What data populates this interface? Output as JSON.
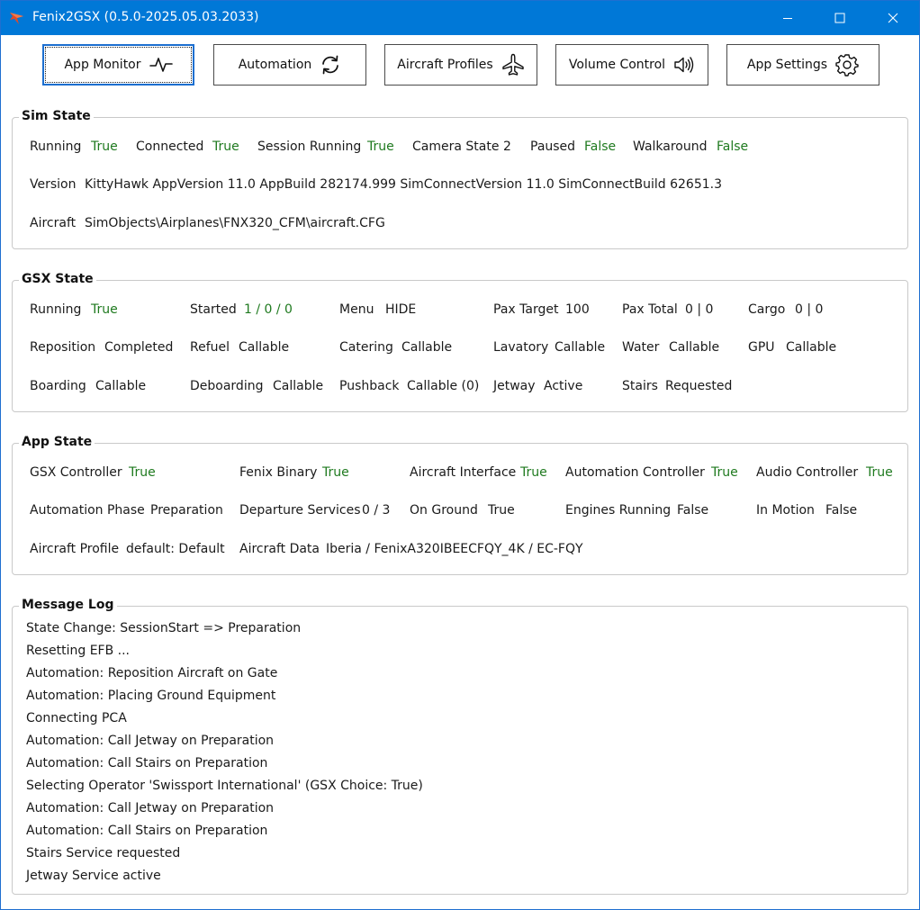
{
  "window": {
    "title": "Fenix2GSX (0.5.0-2025.05.03.2033)"
  },
  "nav": [
    {
      "label": "App Monitor",
      "icon": "activity-icon",
      "active": true
    },
    {
      "label": "Automation",
      "icon": "refresh-icon",
      "active": false
    },
    {
      "label": "Aircraft Profiles",
      "icon": "airplane-icon",
      "active": false
    },
    {
      "label": "Volume Control",
      "icon": "speaker-icon",
      "active": false
    },
    {
      "label": "App Settings",
      "icon": "gear-icon",
      "active": false
    }
  ],
  "colors": {
    "accent": "#0078d7",
    "ok_value": "#1f7a1f"
  },
  "sim_state": {
    "title": "Sim State",
    "running": {
      "label": "Running",
      "value": "True"
    },
    "connected": {
      "label": "Connected",
      "value": "True"
    },
    "session_running": {
      "label": "Session Running",
      "value": "True"
    },
    "camera_state": {
      "label": "Camera State",
      "value": "2"
    },
    "paused": {
      "label": "Paused",
      "value": "False"
    },
    "walkaround": {
      "label": "Walkaround",
      "value": "False"
    },
    "version": {
      "label": "Version",
      "value": "KittyHawk AppVersion 11.0 AppBuild 282174.999 SimConnectVersion 11.0 SimConnectBuild 62651.3"
    },
    "aircraft": {
      "label": "Aircraft",
      "value": "SimObjects\\Airplanes\\FNX320_CFM\\aircraft.CFG"
    }
  },
  "gsx_state": {
    "title": "GSX State",
    "running": {
      "label": "Running",
      "value": "True"
    },
    "started": {
      "label": "Started",
      "value": "1 / 0 / 0"
    },
    "menu": {
      "label": "Menu",
      "value": "HIDE"
    },
    "pax_target": {
      "label": "Pax Target",
      "value": "100"
    },
    "pax_total": {
      "label": "Pax Total",
      "value": "0 | 0"
    },
    "cargo": {
      "label": "Cargo",
      "value": "0 | 0"
    },
    "reposition": {
      "label": "Reposition",
      "value": "Completed"
    },
    "refuel": {
      "label": "Refuel",
      "value": "Callable"
    },
    "catering": {
      "label": "Catering",
      "value": "Callable"
    },
    "lavatory": {
      "label": "Lavatory",
      "value": "Callable"
    },
    "water": {
      "label": "Water",
      "value": "Callable"
    },
    "gpu": {
      "label": "GPU",
      "value": "Callable"
    },
    "boarding": {
      "label": "Boarding",
      "value": "Callable"
    },
    "deboarding": {
      "label": "Deboarding",
      "value": "Callable"
    },
    "pushback": {
      "label": "Pushback",
      "value": "Callable (0)"
    },
    "jetway": {
      "label": "Jetway",
      "value": "Active"
    },
    "stairs": {
      "label": "Stairs",
      "value": "Requested"
    }
  },
  "app_state": {
    "title": "App State",
    "gsx_controller": {
      "label": "GSX Controller",
      "value": "True"
    },
    "fenix_binary": {
      "label": "Fenix Binary",
      "value": "True"
    },
    "aircraft_interface": {
      "label": "Aircraft Interface",
      "value": "True"
    },
    "automation_controller": {
      "label": "Automation Controller",
      "value": "True"
    },
    "audio_controller": {
      "label": "Audio Controller",
      "value": "True"
    },
    "automation_phase": {
      "label": "Automation Phase",
      "value": "Preparation"
    },
    "departure_services": {
      "label": "Departure Services",
      "value": "0 / 3"
    },
    "on_ground": {
      "label": "On Ground",
      "value": "True"
    },
    "engines_running": {
      "label": "Engines Running",
      "value": "False"
    },
    "in_motion": {
      "label": "In Motion",
      "value": "False"
    },
    "aircraft_profile": {
      "label": "Aircraft Profile",
      "value": "default: Default"
    },
    "aircraft_data": {
      "label": "Aircraft Data",
      "value": "Iberia / FenixA320IBEECFQY_4K / EC-FQY"
    }
  },
  "message_log": {
    "title": "Message Log",
    "lines": [
      "State Change: SessionStart => Preparation",
      "Resetting EFB ...",
      "Automation: Reposition Aircraft on Gate",
      "Automation: Placing Ground Equipment",
      "Connecting PCA",
      "Automation: Call Jetway on Preparation",
      "Automation: Call Stairs on Preparation",
      "Selecting Operator 'Swissport International' (GSX Choice: True)",
      "Automation: Call Jetway on Preparation",
      "Automation: Call Stairs on Preparation",
      "Stairs Service requested",
      "Jetway Service active"
    ]
  }
}
